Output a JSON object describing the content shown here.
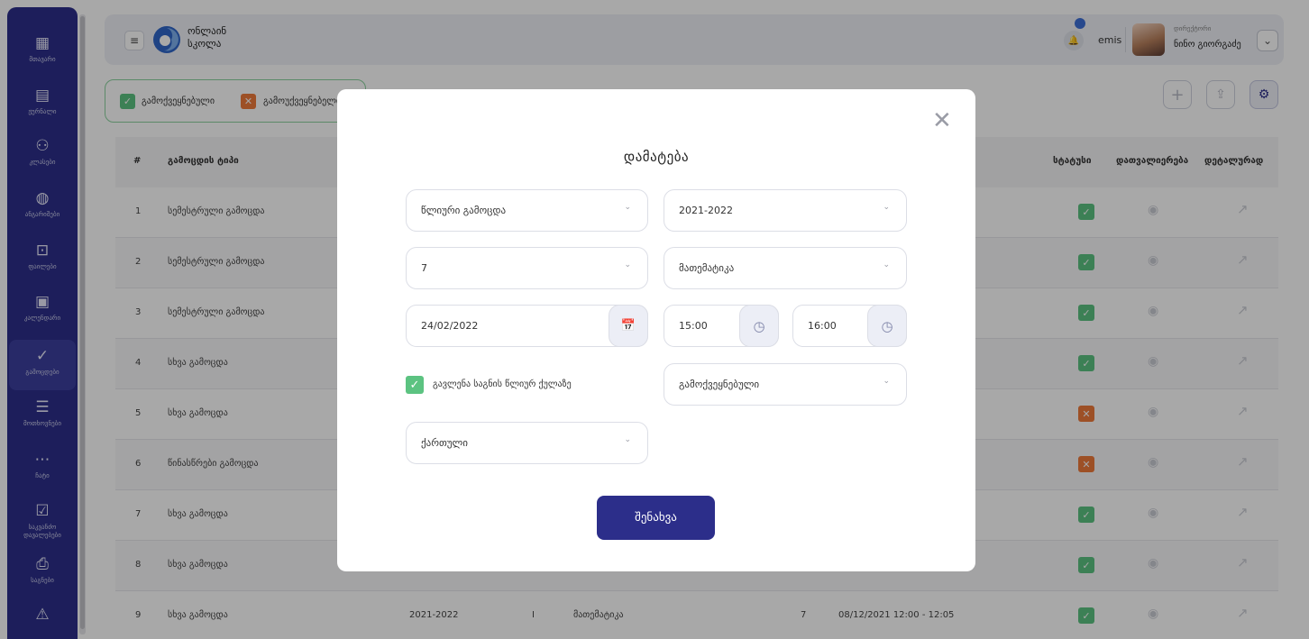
{
  "sidebar": {
    "items": [
      {
        "icon": "dashboard-grid-icon",
        "glyph": "▦",
        "label": "მთავარი"
      },
      {
        "icon": "journal-icon",
        "glyph": "▤",
        "label": "ჟურნალი"
      },
      {
        "icon": "students-icon",
        "glyph": "⚇",
        "label": "კლასები"
      },
      {
        "icon": "reports-chart-icon",
        "glyph": "◍",
        "label": "ანგარიშები"
      },
      {
        "icon": "folder-icon",
        "glyph": "⊡",
        "label": "ფაილები"
      },
      {
        "icon": "calendar-icon",
        "glyph": "▣",
        "label": "კალენდარი"
      },
      {
        "icon": "shield-check-icon",
        "glyph": "✓",
        "label": "გამოცდები"
      },
      {
        "icon": "document-list-icon",
        "glyph": "☰",
        "label": "მოთხოვნები"
      },
      {
        "icon": "chat-icon",
        "glyph": "⋯",
        "label": "ჩატი"
      },
      {
        "icon": "clipboard-icon",
        "glyph": "☑",
        "label": "საკვანძო\nდავალებები"
      },
      {
        "icon": "printer-icon",
        "glyph": "⎙",
        "label": "საგნები"
      },
      {
        "icon": "warning-icon",
        "glyph": "⚠",
        "label": ""
      }
    ]
  },
  "header": {
    "menu_glyph": "≡",
    "logo_text": "ონლაინ\nსკოლა",
    "bell_glyph": "🔔",
    "emis_label": "emis",
    "user_role": "დირექტორი",
    "user_name": "ნინო გიორგაძე",
    "caret_glyph": "⌄"
  },
  "filters": {
    "checked_glyph": "✓",
    "unchecked_glyph": "✕",
    "approved_label": "გამოქვეყნებული",
    "unpublished_label": "გამოუქვეყნებელი"
  },
  "actions": {
    "add_glyph": "+",
    "upload_glyph": "⇪",
    "filter_glyph": "⚙"
  },
  "table": {
    "headers": {
      "index": "#",
      "type": "გამოცდის ტიპი",
      "status": "სტატუსი",
      "view": "დათვალიერება",
      "details": "დეტალურად"
    },
    "rows": [
      {
        "n": "1",
        "type": "სემესტრული გამოცდა",
        "status": "ok",
        "year": "",
        "sem": "",
        "subject": "",
        "grade": "",
        "date": ""
      },
      {
        "n": "2",
        "type": "სემესტრული გამოცდა",
        "status": "ok",
        "year": "",
        "sem": "",
        "subject": "",
        "grade": "",
        "date": ""
      },
      {
        "n": "3",
        "type": "სემესტრული გამოცდა",
        "status": "ok",
        "year": "",
        "sem": "",
        "subject": "",
        "grade": "",
        "date": ""
      },
      {
        "n": "4",
        "type": "სხვა გამოცდა",
        "status": "ok",
        "year": "",
        "sem": "",
        "subject": "",
        "grade": "",
        "date": ""
      },
      {
        "n": "5",
        "type": "სხვა გამოცდა",
        "status": "bad",
        "year": "",
        "sem": "",
        "subject": "",
        "grade": "",
        "date": ""
      },
      {
        "n": "6",
        "type": "წინასწრები გამოცდა",
        "status": "bad",
        "year": "",
        "sem": "",
        "subject": "",
        "grade": "",
        "date": ""
      },
      {
        "n": "7",
        "type": "სხვა გამოცდა",
        "status": "ok",
        "year": "",
        "sem": "",
        "subject": "",
        "grade": "",
        "date": ""
      },
      {
        "n": "8",
        "type": "სხვა გამოცდა",
        "status": "ok",
        "year": "",
        "sem": "",
        "subject": "",
        "grade": "",
        "date": ""
      },
      {
        "n": "9",
        "type": "სხვა გამოცდა",
        "status": "ok",
        "year": "2021-2022",
        "sem": "I",
        "subject": "მათემატიკა",
        "grade": "7",
        "date": "08/12/2021 12:00 - 12:05"
      }
    ],
    "ok_glyph": "✓",
    "bad_glyph": "✕",
    "eye_glyph": "◉",
    "ext_glyph": "↗"
  },
  "modal": {
    "close_glyph": "✕",
    "title": "დამატება",
    "exam_type": "წლიური გამოცდა",
    "academic_year": "2021-2022",
    "grade": "7",
    "subject": "მათემატიკა",
    "date": "24/02/2022",
    "start_time": "15:00",
    "end_time": "16:00",
    "calendar_glyph": "📅",
    "clock_glyph": "◷",
    "chevron_glyph": "⌄",
    "checkbox_glyph": "✓",
    "checkbox_label": "გავლენა საგნის წლიურ ქულაზე",
    "publish_status": "გამოქვეყნებული",
    "language": "ქართული",
    "save_label": "შენახვა"
  }
}
